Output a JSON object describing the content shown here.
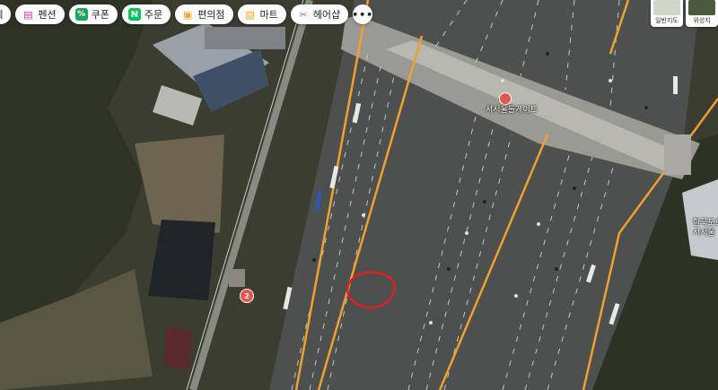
{
  "chips": [
    {
      "label": "[메",
      "icon": "none"
    },
    {
      "label": "펜션",
      "icon": "bed-icon",
      "color": "#c2409a"
    },
    {
      "label": "쿠폰",
      "icon": "coupon-icon",
      "color": "#1ea55b"
    },
    {
      "label": "주문",
      "icon": "n-order-icon",
      "color": "#03c75a"
    },
    {
      "label": "편의점",
      "icon": "store-icon",
      "color": "#f5a623"
    },
    {
      "label": "마트",
      "icon": "cart-icon",
      "color": "#f5a623"
    },
    {
      "label": "헤어샵",
      "icon": "scissors-icon",
      "color": "#e5564e"
    }
  ],
  "more_label": "•••",
  "layers": [
    {
      "label": "일반지도"
    },
    {
      "label": "위성지"
    }
  ],
  "map": {
    "tollgate_label": "서서울톨게이트",
    "poi_marker_number": "2",
    "right_label": "한국도로\n서서울",
    "highlight_color": "#e02020",
    "road_line_color": "#f0a030"
  }
}
